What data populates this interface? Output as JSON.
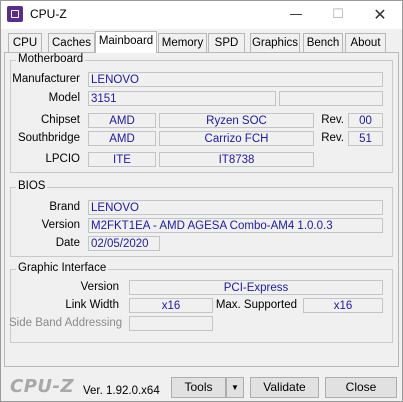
{
  "window": {
    "title": "CPU-Z",
    "minimize_glyph": "—",
    "maximize_glyph": "☐",
    "close_glyph": "✕"
  },
  "tabs": [
    {
      "label": "CPU"
    },
    {
      "label": "Caches"
    },
    {
      "label": "Mainboard"
    },
    {
      "label": "Memory"
    },
    {
      "label": "SPD"
    },
    {
      "label": "Graphics"
    },
    {
      "label": "Bench"
    },
    {
      "label": "About"
    }
  ],
  "active_tab": "Mainboard",
  "motherboard": {
    "title": "Motherboard",
    "manufacturer_label": "Manufacturer",
    "manufacturer": "LENOVO",
    "model_label": "Model",
    "model": "3151",
    "model_extra": "",
    "chipset_label": "Chipset",
    "chipset_vendor": "AMD",
    "chipset_name": "Ryzen SOC",
    "chipset_rev_label": "Rev.",
    "chipset_rev": "00",
    "southbridge_label": "Southbridge",
    "southbridge_vendor": "AMD",
    "southbridge_name": "Carrizo FCH",
    "southbridge_rev_label": "Rev.",
    "southbridge_rev": "51",
    "lpcio_label": "LPCIO",
    "lpcio_vendor": "ITE",
    "lpcio_name": "IT8738"
  },
  "bios": {
    "title": "BIOS",
    "brand_label": "Brand",
    "brand": "LENOVO",
    "version_label": "Version",
    "version": "M2FKT1EA - AMD AGESA Combo-AM4 1.0.0.3",
    "date_label": "Date",
    "date": "02/05/2020"
  },
  "graphic_interface": {
    "title": "Graphic Interface",
    "version_label": "Version",
    "version": "PCI-Express",
    "link_width_label": "Link Width",
    "link_width": "x16",
    "max_supported_label": "Max. Supported",
    "max_supported": "x16",
    "sba_label": "Side Band Addressing",
    "sba": ""
  },
  "footer": {
    "brand": "CPU-Z",
    "version": "Ver. 1.92.0.x64",
    "tools_label": "Tools",
    "tools_arrow": "▼",
    "validate_label": "Validate",
    "close_label": "Close"
  },
  "colors": {
    "value_text": "#1a1aa6",
    "brand_text": "#a8a8a8",
    "app_icon": "#5a2d8c"
  }
}
